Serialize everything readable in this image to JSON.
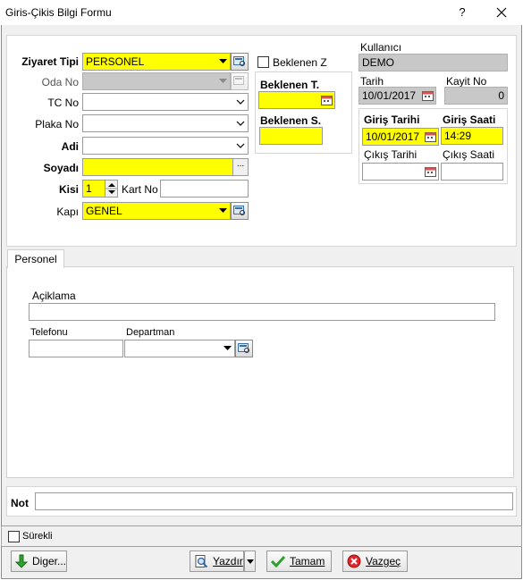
{
  "window": {
    "title": "Giris-Çikis Bilgi Formu",
    "help_label": "?"
  },
  "form": {
    "ziyaret_tipi": {
      "label": "Ziyaret Tipi",
      "value": "PERSONEL"
    },
    "oda_no": {
      "label": "Oda No",
      "value": ""
    },
    "tc_no": {
      "label": "TC No",
      "value": ""
    },
    "plaka_no": {
      "label": "Plaka No",
      "value": ""
    },
    "adi": {
      "label": "Adi",
      "value": ""
    },
    "soyadi": {
      "label": "Soyadı",
      "value": ""
    },
    "kisi": {
      "label": "Kisi",
      "value": "1"
    },
    "kart_no": {
      "label": "Kart No",
      "value": ""
    },
    "kapi": {
      "label": "Kapı",
      "value": "GENEL"
    }
  },
  "beklenen": {
    "checkbox_label": "Beklenen Z",
    "t_label": "Beklenen T.",
    "t_value": "",
    "s_label": "Beklenen S.",
    "s_value": ""
  },
  "info": {
    "kullanici_label": "Kullanıcı",
    "kullanici_value": "DEMO",
    "tarih_label": "Tarih",
    "tarih_value": "10/01/2017",
    "kayit_no_label": "Kayit No",
    "kayit_no_value": "0"
  },
  "entry": {
    "giris_tarihi_label": "Giriş Tarihi",
    "giris_tarihi_value": "10/01/2017",
    "giris_saati_label": "Giriş Saati",
    "giris_saati_value": "14:29",
    "cikis_tarihi_label": "Çıkış Tarihi",
    "cikis_tarihi_value": "",
    "cikis_saati_label": "Çıkış Saati",
    "cikis_saati_value": ""
  },
  "tabs": [
    {
      "label": "Personel",
      "active": true
    }
  ],
  "personel": {
    "aciklama_label": "Açiklama",
    "aciklama_value": "",
    "telefonu_label": "Telefonu",
    "telefonu_value": "",
    "departman_label": "Departman",
    "departman_value": ""
  },
  "not": {
    "label": "Not",
    "value": ""
  },
  "footer": {
    "surekli_label": "Sürekli",
    "diger_label": "Diger...",
    "yazdir_label": "Yazdır",
    "tamam_label": "Tamam",
    "vazgec_label": "Vazgeç"
  },
  "colors": {
    "required_field": "#ffff00",
    "disabled_field": "#c8c8c8"
  }
}
